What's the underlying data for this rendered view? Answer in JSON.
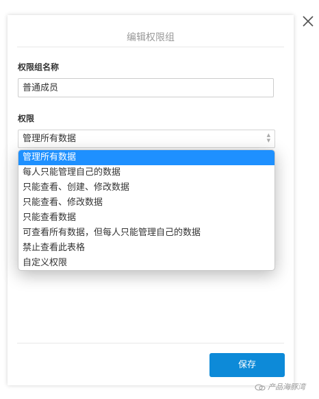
{
  "modal": {
    "title": "编辑权限组",
    "name_label": "权限组名称",
    "name_value": "普通成员",
    "permission_label": "权限",
    "selected_permission": "管理所有数据",
    "save_label": "保存"
  },
  "permission_options": [
    {
      "label": "管理所有数据",
      "selected": true
    },
    {
      "label": "每人只能管理自己的数据",
      "selected": false
    },
    {
      "label": "只能查看、创建、修改数据",
      "selected": false
    },
    {
      "label": "只能查看、修改数据",
      "selected": false
    },
    {
      "label": "只能查看数据",
      "selected": false
    },
    {
      "label": "可查看所有数据，但每人只能管理自己的数据",
      "selected": false
    },
    {
      "label": "禁止查看此表格",
      "selected": false
    },
    {
      "label": "自定义权限",
      "selected": false
    }
  ],
  "watermark": "产品海豚湾",
  "colors": {
    "accent": "#1e90ff",
    "save_button": "#0d8ad8"
  },
  "icons": {
    "close": "close-icon",
    "select_arrows": "select-arrows-icon",
    "watermark": "wechat-icon"
  }
}
